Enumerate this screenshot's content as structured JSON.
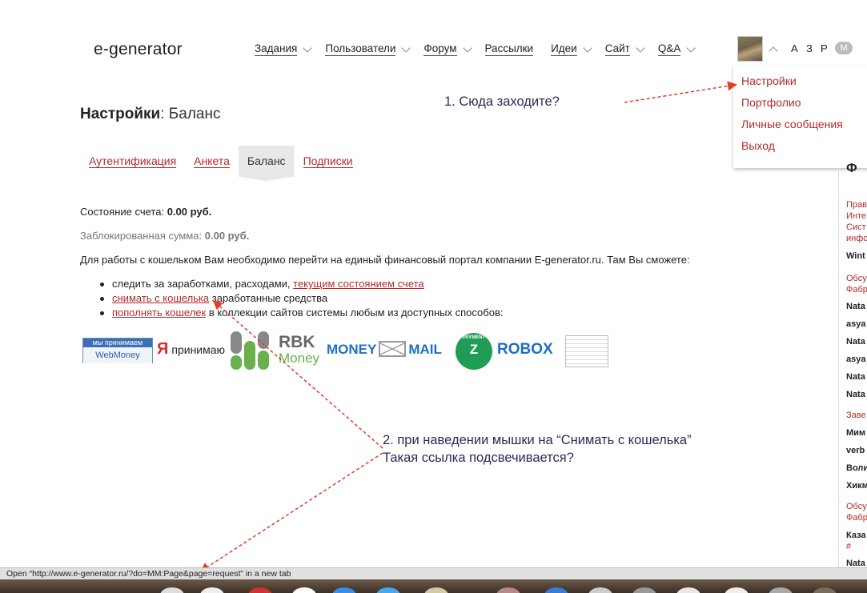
{
  "header": {
    "logo": "e-generator",
    "nav": [
      {
        "label": "Задания",
        "chevron": true
      },
      {
        "label": "Пользователи",
        "chevron": true
      },
      {
        "label": "Форум",
        "chevron": true
      },
      {
        "label": "Рассылки",
        "chevron": false
      },
      {
        "label": "Идеи",
        "chevron": true
      },
      {
        "label": "Сайт",
        "chevron": true
      },
      {
        "label": "Q&A",
        "chevron": true
      }
    ],
    "lang": [
      "А",
      "З",
      "Р"
    ],
    "lang_badge": "M"
  },
  "user_menu": {
    "items": [
      "Настройки",
      "Портфолио",
      "Личные сообщения",
      "Выход"
    ]
  },
  "page": {
    "title_bold": "Настройки",
    "title_rest": ": Баланс",
    "tabs": [
      {
        "label": "Аутентификация",
        "active": false
      },
      {
        "label": "Анкета",
        "active": false
      },
      {
        "label": "Баланс",
        "active": true
      },
      {
        "label": "Подписки",
        "active": false
      }
    ],
    "balance_label": "Состояние счета:",
    "balance_value": "0.00 руб.",
    "blocked_label": "Заблокированная сумма:",
    "blocked_value": "0.00 руб.",
    "intro": "Для работы с кошельком Вам необходимо перейти на единый финансовый портал компании E-generator.ru. Там Вы сможете:",
    "bullets": [
      {
        "pre": "следить за заработками, расходами, ",
        "link": "текущим состоянием счета",
        "post": ""
      },
      {
        "pre": "",
        "link": "снимать с кошелька",
        "post": " заработанные средства"
      },
      {
        "pre": "",
        "link": "пополнять кошелек",
        "post": " в коллекции сайтов системы любым из доступных способов:"
      }
    ],
    "payments": {
      "webmoney_top": "мы принимаем",
      "webmoney_bottom": "WebMoney",
      "yandex_letter": "Я",
      "yandex_text": "принимаю",
      "rbk_line1": "RBK",
      "rbk_line2": "Money",
      "moneymail_1": "MONEY",
      "moneymail_2": "MAIL",
      "zpayment_top": "PAYMENT",
      "zpayment_letter": "Z",
      "robox": "ROBOX"
    }
  },
  "annotations": {
    "note1": "1. Сюда заходите?",
    "note2_line1": "2. при наведении мышки на “Снимать с кошелька”",
    "note2_line2": "Такая ссылка подсвечивается?",
    "arrow_color": "#e03c2c"
  },
  "sidebar": {
    "heading": "Ф",
    "items": [
      {
        "text": "Прав",
        "style": "red"
      },
      {
        "text": "Инте",
        "style": "red"
      },
      {
        "text": "Сист",
        "style": "red"
      },
      {
        "text": "инфо",
        "style": "red"
      },
      {
        "text": "Wint",
        "style": "bold"
      },
      {
        "text": "Обсу",
        "style": "red"
      },
      {
        "text": "Фабр",
        "style": "red"
      },
      {
        "text": "Nata",
        "style": "bold"
      },
      {
        "text": "asya",
        "style": "bold"
      },
      {
        "text": "Nata",
        "style": "bold"
      },
      {
        "text": "asya",
        "style": "bold"
      },
      {
        "text": "Nata",
        "style": "bold"
      },
      {
        "text": "Nata",
        "style": "bold"
      },
      {
        "text": "Заве",
        "style": "red"
      },
      {
        "text": "Мим",
        "style": "bold"
      },
      {
        "text": "verb",
        "style": "bold"
      },
      {
        "text": "Воли",
        "style": "bold"
      },
      {
        "text": "Хикм",
        "style": "bold"
      },
      {
        "text": "Обсу",
        "style": "red"
      },
      {
        "text": "Фабр",
        "style": "red"
      },
      {
        "text": "Каза",
        "style": "bold"
      },
      {
        "text": "#",
        "style": "red"
      },
      {
        "text": "Nata",
        "style": "bold"
      }
    ]
  },
  "status_bar": "Open “http://www.e-generator.ru/?do=MM:Page&page=request” in a new tab",
  "colors": {
    "accent": "#b22a2a",
    "link": "#b22a2a"
  }
}
